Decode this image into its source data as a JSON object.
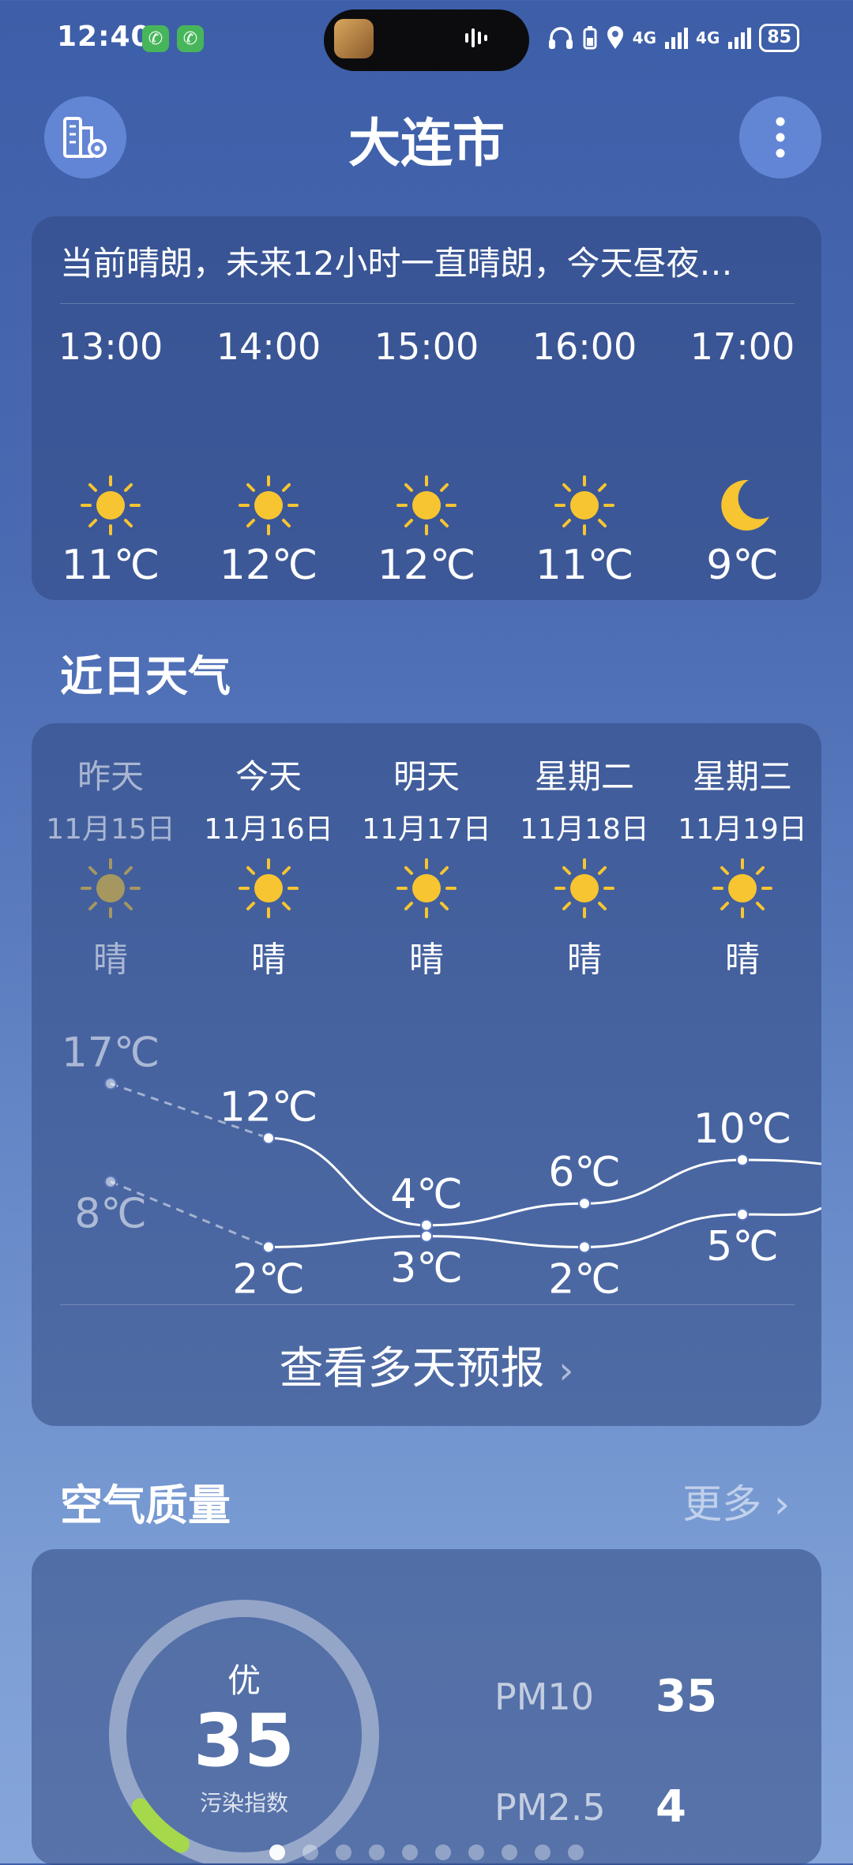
{
  "status_bar": {
    "time": "12:40",
    "network_1": "4G",
    "network_2": "4G",
    "battery": "85"
  },
  "header": {
    "city": "大连市",
    "left_icon": "city-manage-icon",
    "right_icon": "more-vertical-icon"
  },
  "hourly": {
    "summary": "当前晴朗，未来12小时一直晴朗，今天昼夜…",
    "items": [
      {
        "time": "13:00",
        "icon": "sun-icon",
        "temp": "11℃"
      },
      {
        "time": "14:00",
        "icon": "sun-icon",
        "temp": "12℃"
      },
      {
        "time": "15:00",
        "icon": "sun-icon",
        "temp": "12℃"
      },
      {
        "time": "16:00",
        "icon": "sun-icon",
        "temp": "11℃"
      },
      {
        "time": "17:00",
        "icon": "moon-icon",
        "temp": "9℃"
      }
    ]
  },
  "recent": {
    "title": "近日天气",
    "days": [
      {
        "name": "昨天",
        "date": "11月15日",
        "condition": "晴",
        "high": "17℃",
        "low": "8℃"
      },
      {
        "name": "今天",
        "date": "11月16日",
        "condition": "晴",
        "high": "12℃",
        "low": "2℃"
      },
      {
        "name": "明天",
        "date": "11月17日",
        "condition": "晴",
        "high": "4℃",
        "low": "3℃"
      },
      {
        "name": "星期二",
        "date": "11月18日",
        "condition": "晴",
        "high": "6℃",
        "low": "2℃"
      },
      {
        "name": "星期三",
        "date": "11月19日",
        "condition": "晴",
        "high": "10℃",
        "low": "5℃"
      }
    ],
    "more_forecast": "查看多天预报"
  },
  "chart_data": {
    "type": "line",
    "x": [
      "昨天",
      "今天",
      "明天",
      "星期二",
      "星期三"
    ],
    "series": [
      {
        "values": [
          17,
          12,
          4,
          6,
          10
        ]
      },
      {
        "values": [
          8,
          2,
          3,
          2,
          5
        ]
      }
    ]
  },
  "air": {
    "title": "空气质量",
    "more": "更多",
    "level": "优",
    "aqi": "35",
    "aqi_label": "污染指数",
    "aqi_fraction": 0.07,
    "pollutants": [
      {
        "name": "PM10",
        "value": "35"
      },
      {
        "name": "PM2.5",
        "value": "4"
      }
    ]
  },
  "page_indicator": {
    "count": 10,
    "active": 0
  },
  "colors": {
    "accent_sun": "#f7c531",
    "gauge_green": "#a6d84c"
  }
}
